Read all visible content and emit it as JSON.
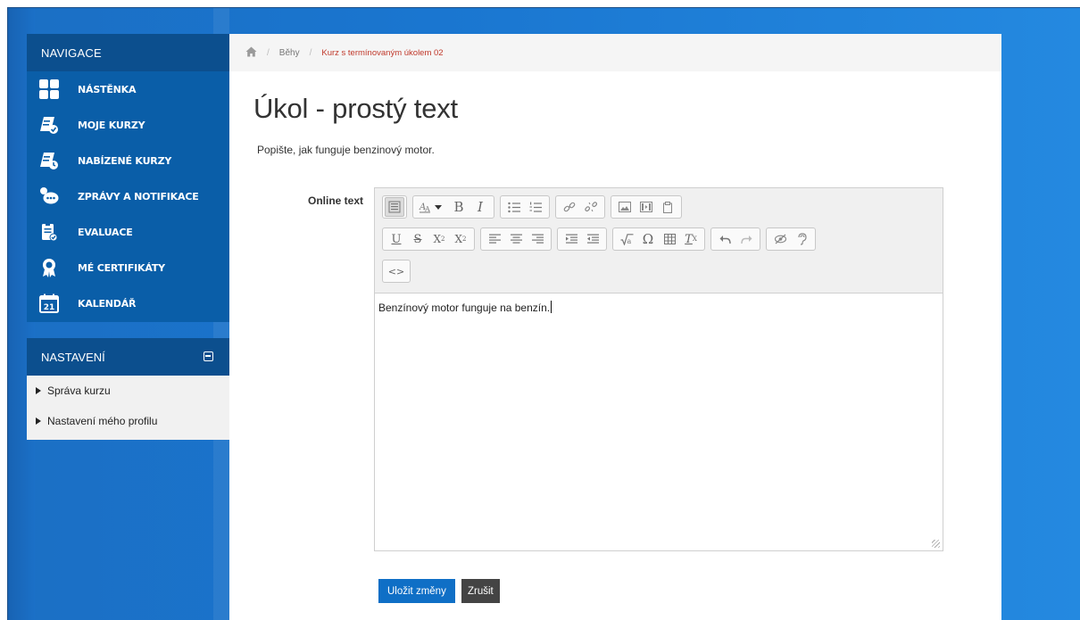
{
  "navigation": {
    "header": "NAVIGACE",
    "items": [
      {
        "label": "NÁSTĚNKA",
        "icon": "dashboard-icon"
      },
      {
        "label": "MOJE KURZY",
        "icon": "my-courses-icon"
      },
      {
        "label": "NABÍZENÉ KURZY",
        "icon": "offered-courses-icon"
      },
      {
        "label": "ZPRÁVY A NOTIFIKACE",
        "icon": "messages-icon"
      },
      {
        "label": "EVALUACE",
        "icon": "evaluation-icon"
      },
      {
        "label": "MÉ CERTIFIKÁTY",
        "icon": "certificate-icon"
      },
      {
        "label": "KALENDÁŘ",
        "icon": "calendar-icon",
        "badge": "21"
      }
    ]
  },
  "settings": {
    "header": "NASTAVENÍ",
    "links": [
      "Správa kurzu",
      "Nastavení mého profilu"
    ]
  },
  "breadcrumb": {
    "separator": "/",
    "items": [
      "Běhy",
      "Kurz s termínovaným úkolem 02"
    ]
  },
  "page": {
    "title": "Úkol - prostý text",
    "description": "Popište, jak funguje benzinový motor."
  },
  "form": {
    "field_label": "Online text",
    "editor_content": "Benzínový motor funguje na benzín.",
    "save_label": "Uložit změny",
    "cancel_label": "Zrušit"
  },
  "toolbar": {
    "bold": "B",
    "italic": "I",
    "underline": "U",
    "strike": "S",
    "subscript": "X",
    "subscript_mark": "2",
    "superscript": "X",
    "superscript_mark": "2",
    "omega": "Ω",
    "clear_format": "T",
    "clear_format_mark": "X",
    "html": "<>"
  },
  "colors": {
    "sidebar": "#0a5ea8",
    "sidebar_header": "#0c4f8e",
    "background": "#1a76d0",
    "primary_button": "#0f6fc6",
    "secondary_button": "#444444",
    "breadcrumb_current": "#c0392b"
  }
}
